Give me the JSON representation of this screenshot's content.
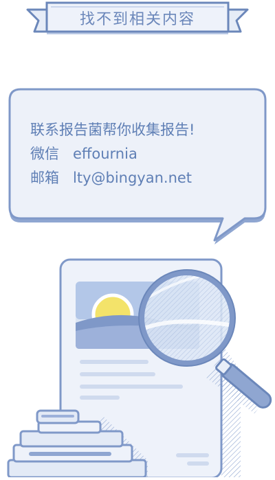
{
  "banner": {
    "title": "找不到相关内容"
  },
  "contact": {
    "headline": "联系报告菌帮你收集报告!",
    "wechat_label": "微信",
    "wechat_value": "effournia",
    "email_label": "邮箱",
    "email_value": "lty@bingyan.net"
  },
  "colors": {
    "primary": "#6b87ba",
    "stroke": "#7f98c8",
    "fill_light": "#e8eef8",
    "sun": "#f3e36a"
  },
  "icons": {
    "illustration": "document-magnifier-books-illustration"
  }
}
